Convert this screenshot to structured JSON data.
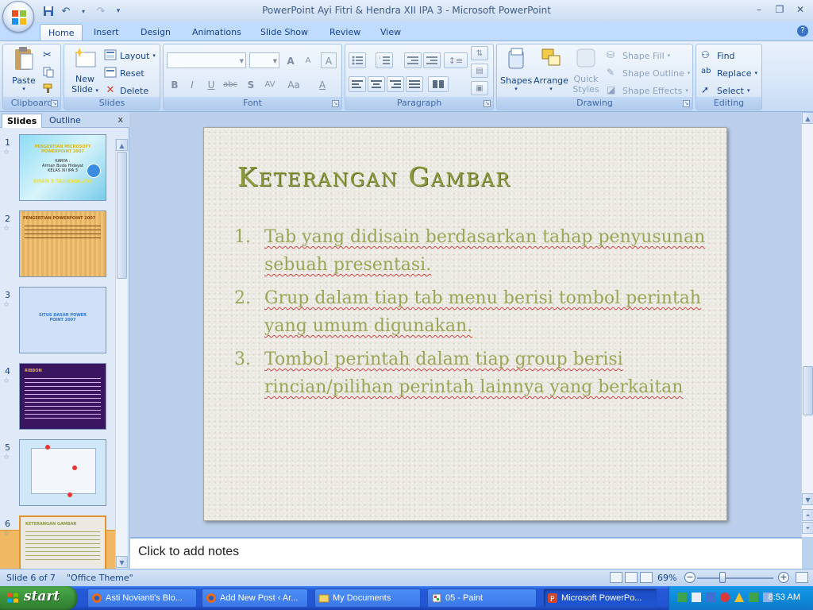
{
  "window": {
    "title": "PowerPoint Ayi Fitri & Hendra XII IPA 3 - Microsoft PowerPoint"
  },
  "quick_access": {
    "save_icon": "save-icon",
    "undo_icon": "undo-icon",
    "redo_icon": "redo-icon",
    "customize_icon": "customize-qat-icon"
  },
  "window_controls": {
    "minimize": "–",
    "restore": "❐",
    "close": "✕"
  },
  "ribbon": {
    "tabs": [
      {
        "label": "Home",
        "active": true
      },
      {
        "label": "Insert"
      },
      {
        "label": "Design"
      },
      {
        "label": "Animations"
      },
      {
        "label": "Slide Show"
      },
      {
        "label": "Review"
      },
      {
        "label": "View"
      }
    ],
    "clipboard": {
      "label": "Clipboard",
      "paste": "Paste"
    },
    "slides": {
      "label": "Slides",
      "new_slide_1": "New",
      "new_slide_2": "Slide",
      "layout": "Layout",
      "reset": "Reset",
      "delete": "Delete"
    },
    "font": {
      "label": "Font",
      "bold": "B",
      "italic": "I",
      "underline": "U",
      "strike": "abc",
      "shadow": "S",
      "spacing": "AV",
      "case": "Aa",
      "color": "A",
      "grow": "A",
      "shrink": "A"
    },
    "paragraph": {
      "label": "Paragraph"
    },
    "drawing": {
      "label": "Drawing",
      "shapes": "Shapes",
      "arrange": "Arrange",
      "quick_styles_1": "Quick",
      "quick_styles_2": "Styles",
      "shape_fill": "Shape Fill",
      "shape_outline": "Shape Outline",
      "shape_effects": "Shape Effects"
    },
    "editing": {
      "label": "Editing",
      "find": "Find",
      "replace": "Replace",
      "select": "Select"
    }
  },
  "left_pane": {
    "tabs": [
      "Slides",
      "Outline"
    ],
    "close": "x",
    "thumbnails": [
      {
        "number": "1",
        "title": "PENGERTIAN MICROSOFT POWERPOINT 2007",
        "sub1": "KARYA :",
        "sub2": "Arman Buda Hidayat",
        "sub3": "KELAS XII IPA 3",
        "footer": "SMAN 3 TASIKMALAYA"
      },
      {
        "number": "2",
        "title": "PENGERTIAN POWERPOINT 2007"
      },
      {
        "number": "3",
        "title": "SITUS DASAR POWER POINT 2007"
      },
      {
        "number": "4",
        "title": "RIBBON"
      },
      {
        "number": "5",
        "title": ""
      },
      {
        "number": "6",
        "title": "KETERANGAN GAMBAR"
      }
    ]
  },
  "slide": {
    "title": "Keterangan Gambar",
    "items": [
      {
        "num": "1.",
        "text": "Tab yang didisain berdasarkan tahap penyusunan sebuah presentasi."
      },
      {
        "num": "2.",
        "text": "Grup dalam tiap tab menu berisi tombol perintah yang umum digunakan."
      },
      {
        "num": "3.",
        "text": "Tombol perintah dalam tiap group berisi rincian/pilihan perintah lainnya yang berkaitan"
      }
    ]
  },
  "notes": {
    "placeholder": "Click to add notes"
  },
  "status": {
    "slide_info": "Slide 6 of 7",
    "theme": "\"Office Theme\"",
    "zoom": "69%",
    "zoom_level": 0.69
  },
  "taskbar": {
    "start": "start",
    "tasks": [
      {
        "label": "Asti Novianti's Blo...",
        "icon": "firefox-icon"
      },
      {
        "label": "Add New Post ‹ Ar...",
        "icon": "firefox-icon"
      },
      {
        "label": "My Documents",
        "icon": "folder-icon"
      },
      {
        "label": "05 - Paint",
        "icon": "paint-icon"
      },
      {
        "label": "Microsoft PowerPo...",
        "icon": "powerpoint-icon",
        "active": true
      }
    ],
    "clock": "8:53 AM"
  },
  "colors": {
    "accent": "#15428b",
    "slide_title": "#8a9a3c",
    "slide_text": "#9aa556",
    "taskbar": "#2458d6",
    "selected_thumb": "#f0b862"
  }
}
